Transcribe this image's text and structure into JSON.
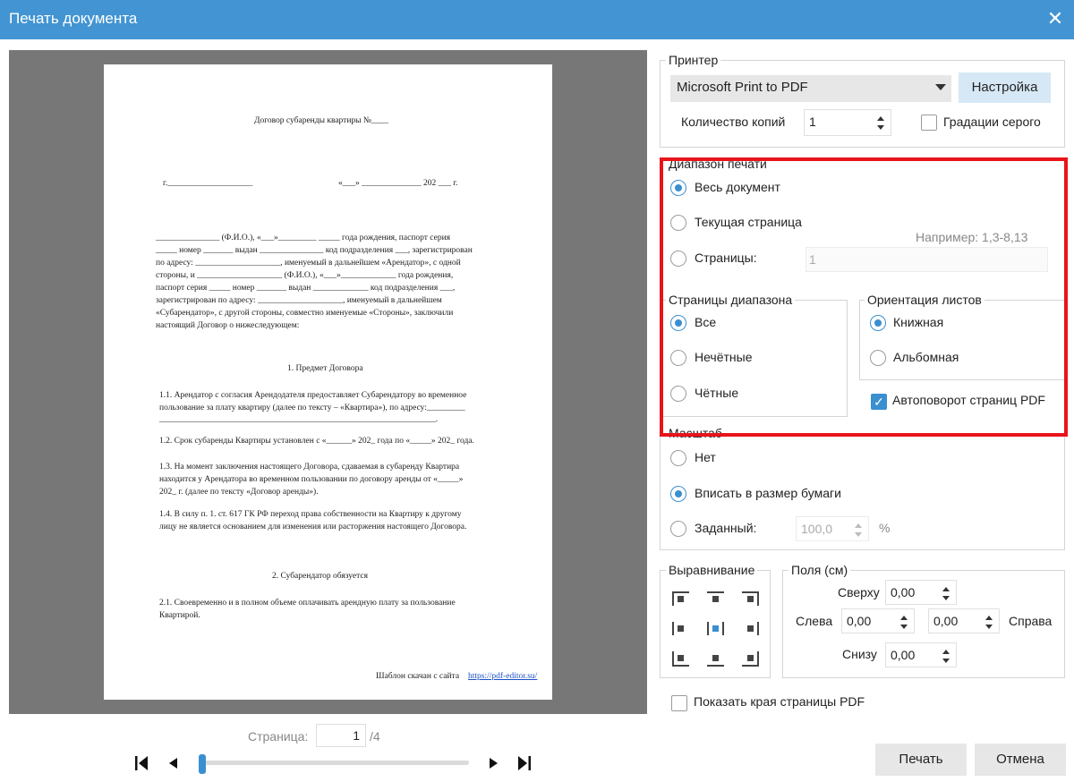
{
  "window": {
    "title": "Печать документа",
    "close_glyph": "✕"
  },
  "preview": {
    "doc_title": "Договор субаренды квартиры №____",
    "city_line_left": "г.____________________",
    "city_line_right": "«___» ______________ 202 ___ г.",
    "intro": [
      "_______________ (Ф.И.О.), «___»_________ _____ года рождения, паспорт серия",
      "_____ номер _______ выдан _______________ код подразделения ___, зарегистрирован",
      "по адресу: ____________________, именуемый в дальнейшем «Арендатор», с одной",
      "стороны, и ____________________ (Ф.И.О.), «___»_____________ года рождения,",
      "паспорт серия _____ номер _______ выдан _____________ код подразделения ___,",
      "зарегистрирован по адресу: ____________________, именуемый в дальнейшем",
      "«Субарендатор», с другой стороны, совместно именуемые «Стороны», заключили",
      "настоящий Договор о нижеследующем:"
    ],
    "section1_title": "1. Предмет Договора",
    "p11": [
      "1.1. Арендатор с согласия Арендодателя предоставляет Субарендатору во временное",
      "пользование за плату квартиру (далее по тексту – «Квартира»), по адресу:_________",
      "_________________________________________________________________."
    ],
    "p12": [
      "1.2. Срок субаренды Квартиры установлен с «______» 202_ года по «_____» 202_ года."
    ],
    "p13": [
      "1.3. На момент заключения настоящего Договора, сдаваемая в субаренду Квартира",
      "находится у Арендатора во временном пользовании по договору аренды от «_____»",
      "202_ г. (далее по тексту «Договор аренды»)."
    ],
    "p14": [
      "1.4. В силу п. 1. ст. 617 ГК РФ переход права собственности на Квартиру к другому",
      "лицу не является основанием для изменения или расторжения настоящего Договора."
    ],
    "section2_title": "2. Субарендатор обязуется",
    "p21": [
      "2.1. Своевременно и в полном объеме оплачивать арендную плату за пользование",
      "Квартирой."
    ],
    "footer_text": "Шаблон скачан с сайта",
    "footer_link": "https://pdf-editor.su/"
  },
  "nav": {
    "page_label": "Страница:",
    "current_page": "1",
    "total": "/4",
    "position_fraction": 0.0
  },
  "printer": {
    "legend": "Принтер",
    "selected": "Microsoft Print to PDF",
    "setup_button": "Настройка",
    "copies_label": "Количество копий",
    "copies_value": "1",
    "grayscale_label": "Градации серого",
    "grayscale_checked": false
  },
  "range": {
    "legend": "Диапазон печати",
    "options": [
      "Весь документ",
      "Текущая страница",
      "Страницы:"
    ],
    "selected_index": 0,
    "hint": "Например: 1,3-8,13",
    "pages_placeholder": "1"
  },
  "subset": {
    "legend": "Страницы диапазона",
    "options": [
      "Все",
      "Нечётные",
      "Чётные"
    ],
    "selected_index": 0
  },
  "orientation": {
    "legend": "Ориентация листов",
    "options": [
      "Книжная",
      "Альбомная"
    ],
    "selected_index": 0,
    "autorotate_label": "Автоповорот страниц PDF",
    "autorotate_checked": true
  },
  "scale": {
    "legend": "Масштаб",
    "options": [
      "Нет",
      "Вписать в размер бумаги",
      "Заданный:"
    ],
    "selected_index": 1,
    "custom_value": "100,0",
    "unit": "%"
  },
  "alignment": {
    "legend": "Выравнивание",
    "selected": "center"
  },
  "margins": {
    "legend": "Поля (см)",
    "top_label": "Сверху",
    "top_value": "0,00",
    "left_label": "Слева",
    "left_value": "0,00",
    "right_label": "Справа",
    "right_value": "0,00",
    "bottom_label": "Снизу",
    "bottom_value": "0,00"
  },
  "show_edges_label": "Показать края страницы PDF",
  "show_edges_checked": false,
  "actions": {
    "print": "Печать",
    "cancel": "Отмена"
  },
  "colors": {
    "accent": "#4294d2",
    "highlight": "#e8141b",
    "preview_bg": "#777777"
  }
}
